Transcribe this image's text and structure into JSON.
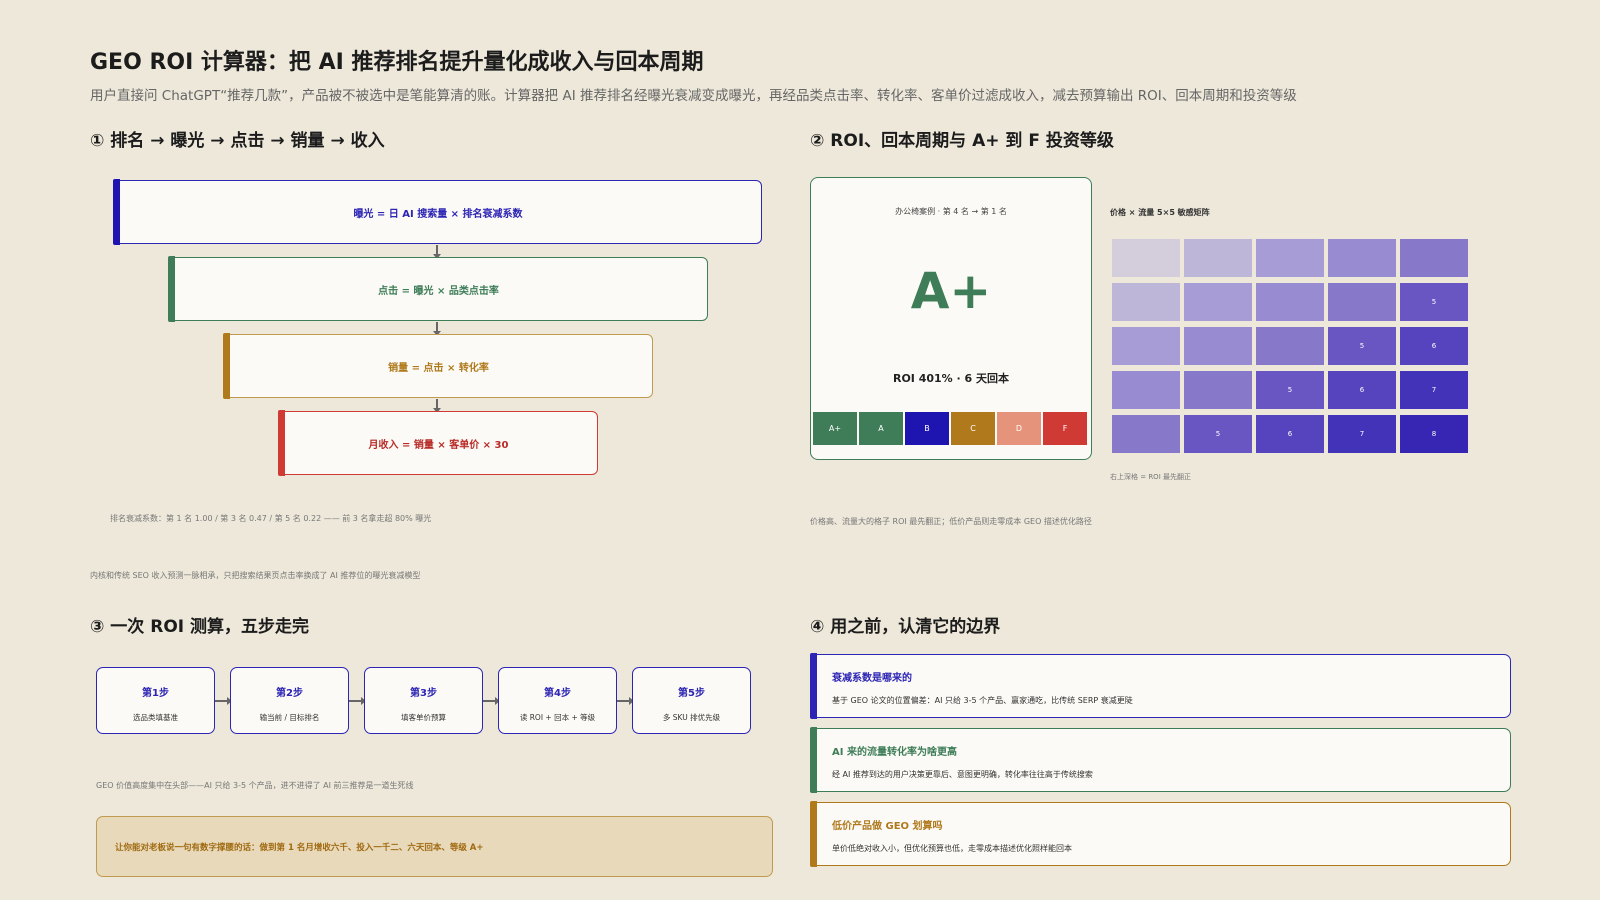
{
  "title": "GEO ROI 计算器：把 AI 推荐排名提升量化成收入与回本周期",
  "subtitle": "用户直接问 ChatGPT“推荐几款”，产品被不被选中是笔能算清的账。计算器把 AI 推荐排名经曝光衰减变成曝光，再经品类点击率、转化率、客单价过滤成收入，减去预算输出 ROI、回本周期和投资等级",
  "colors": {
    "blue": "#2d25b4",
    "green": "#3e7d58",
    "gold": "#b07a1c",
    "red": "#d03a35",
    "bg": "#ede8da",
    "card": "#fbfaf6"
  },
  "section1": {
    "title": "① 排名 → 曝光 → 点击 → 销量 → 收入",
    "steps": [
      "曝光 = 日 AI 搜索量 × 排名衰减系数",
      "点击 = 曝光 × 品类点击率",
      "销量 = 点击 × 转化率",
      "月收入 = 销量 × 客单价 × 30"
    ],
    "note": "排名衰减系数：第 1 名 1.00 / 第 3 名 0.47 / 第 5 名 0.22 —— 前 3 名拿走超 80% 曝光",
    "footnote": "内核和传统 SEO 收入预测一脉相承，只把搜索结果页点击率换成了 AI 推荐位的曝光衰减模型"
  },
  "section2": {
    "title": "② ROI、回本周期与 A+ 到 F 投资等级",
    "card_caption": "办公椅案例 · 第 4 名 → 第 1 名",
    "grade": "A+",
    "result": "ROI 401% · 6 天回本",
    "grades": [
      {
        "label": "A+",
        "color": "#3e7d58"
      },
      {
        "label": "A",
        "color": "#3e7d58"
      },
      {
        "label": "B",
        "color": "#1e14b0"
      },
      {
        "label": "C",
        "color": "#b07a1c"
      },
      {
        "label": "D",
        "color": "#e5937a"
      },
      {
        "label": "F",
        "color": "#d03a35"
      }
    ],
    "matrix_title": "价格 × 流量 5×5 敏感矩阵",
    "matrix": [
      [
        "",
        "",
        "",
        "",
        ""
      ],
      [
        "",
        "",
        "",
        "",
        "5"
      ],
      [
        "",
        "",
        "",
        "5",
        "6"
      ],
      [
        "",
        "",
        "5",
        "6",
        "7"
      ],
      [
        "",
        "5",
        "6",
        "7",
        "8"
      ]
    ],
    "matrix_colors": [
      [
        "#d4cedc",
        "#beb6d9",
        "#a89cd6",
        "#988bd1",
        "#8878c9"
      ],
      [
        "#beb6d9",
        "#a89cd6",
        "#988bd1",
        "#8878c9",
        "#6956c3"
      ],
      [
        "#a89cd6",
        "#988bd1",
        "#8878c9",
        "#6956c3",
        "#5544bd"
      ],
      [
        "#988bd1",
        "#8878c9",
        "#6956c3",
        "#5544bd",
        "#4333b9"
      ],
      [
        "#8878c9",
        "#6956c3",
        "#5544bd",
        "#4333b9",
        "#3626b3"
      ]
    ],
    "matrix_note": "右上深格 = ROI 最先翻正",
    "note": "价格高、流量大的格子 ROI 最先翻正；低价产品则走零成本 GEO 描述优化路径"
  },
  "section3": {
    "title": "③ 一次 ROI 测算，五步走完",
    "steps": [
      {
        "t": "第1步",
        "d": "选品类填基准"
      },
      {
        "t": "第2步",
        "d": "输当前 / 目标排名"
      },
      {
        "t": "第3步",
        "d": "填客单价预算"
      },
      {
        "t": "第4步",
        "d": "读 ROI + 回本 + 等级"
      },
      {
        "t": "第5步",
        "d": "多 SKU 排优先级"
      }
    ],
    "note": "GEO 价值高度集中在头部——AI 只给 3-5 个产品，进不进得了 AI 前三推荐是一道生死线",
    "callout": "让你能对老板说一句有数字撑腰的话：做到第 1 名月增收六千、投入一千二、六天回本、等级 A+"
  },
  "section4": {
    "title": "④ 用之前，认清它的边界",
    "items": [
      {
        "t": "衰减系数是哪来的",
        "d": "基于 GEO 论文的位置偏差：AI 只给 3-5 个产品、赢家通吃，比传统 SERP 衰减更陡",
        "color": "#2d25b4"
      },
      {
        "t": "AI 来的流量转化率为啥更高",
        "d": "经 AI 推荐到达的用户决策更靠后、意图更明确，转化率往往高于传统搜索",
        "color": "#3e7d58"
      },
      {
        "t": "低价产品做 GEO 划算吗",
        "d": "单价低绝对收入小，但优化预算也低，走零成本描述优化照样能回本",
        "color": "#b07a1c"
      }
    ]
  }
}
